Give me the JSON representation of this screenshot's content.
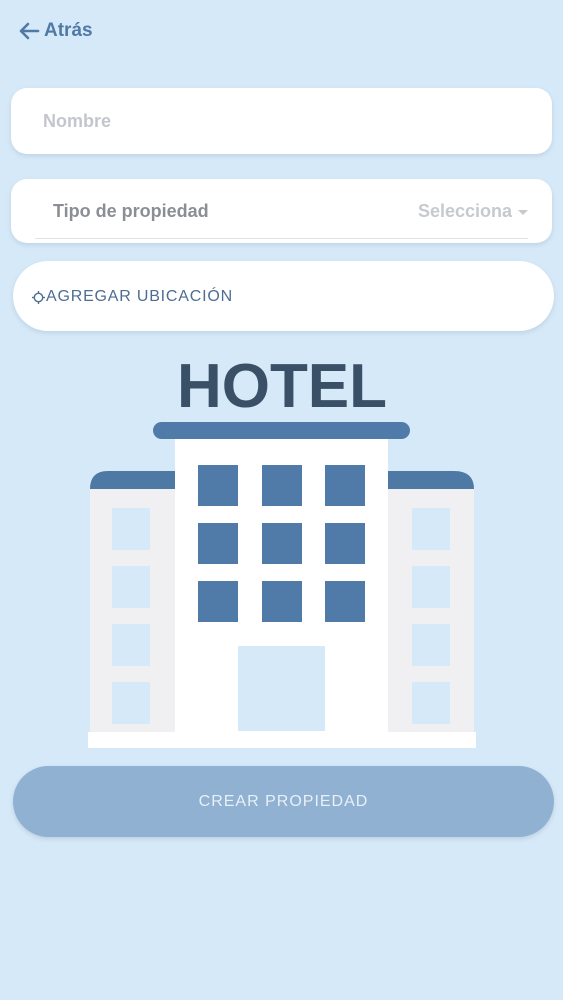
{
  "header": {
    "back_label": "Atrás"
  },
  "form": {
    "name": {
      "placeholder": "Nombre",
      "value": ""
    },
    "property_type": {
      "label": "Tipo de propiedad",
      "selected": "Selecciona"
    },
    "location_button": {
      "label": "AGREGAR UBICACIÓN"
    }
  },
  "illustration": {
    "sign_text": "HOTEL"
  },
  "actions": {
    "create_label": "CREAR PROPIEDAD"
  },
  "colors": {
    "background": "#d6e9f8",
    "accent": "#4f7aa6",
    "button_disabled": "#90b1d1",
    "sign_text": "#3a5066"
  },
  "icons": {
    "back": "arrow-left-icon",
    "location": "location-crosshair-icon",
    "dropdown": "caret-down-icon"
  }
}
